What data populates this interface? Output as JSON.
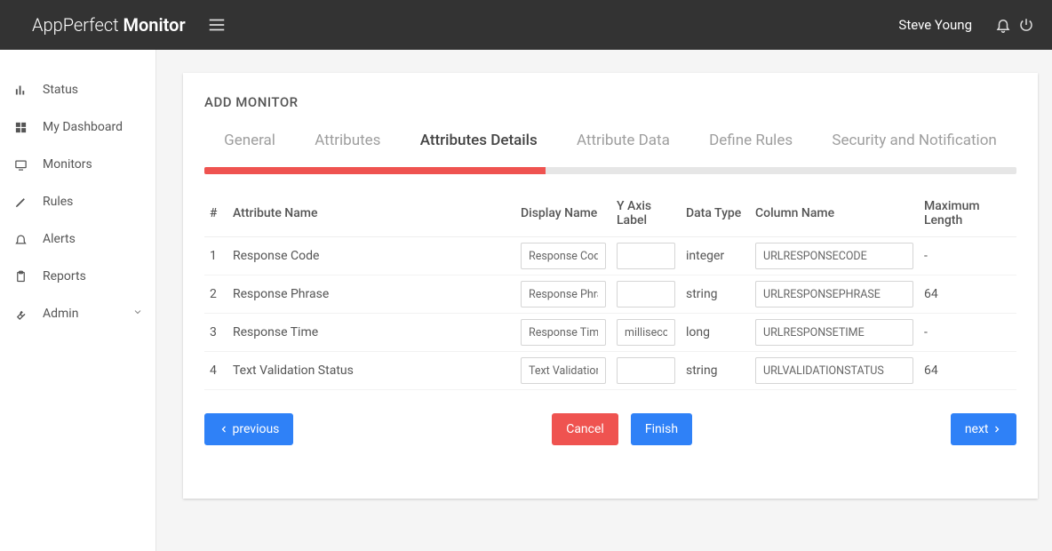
{
  "brand": {
    "name1": "AppPerfect",
    "name2": "Monitor"
  },
  "user": {
    "name": "Steve Young"
  },
  "sidebar": {
    "items": [
      {
        "label": "Status"
      },
      {
        "label": "My Dashboard"
      },
      {
        "label": "Monitors"
      },
      {
        "label": "Rules"
      },
      {
        "label": "Alerts"
      },
      {
        "label": "Reports"
      },
      {
        "label": "Admin"
      }
    ]
  },
  "card": {
    "title": "ADD MONITOR",
    "tabs": {
      "t0": "General",
      "t1": "Attributes",
      "t2": "Attributes Details",
      "t3": "Attribute Data",
      "t4": "Define Rules",
      "t5": "Security and Notification"
    },
    "progress_percent": 42
  },
  "columns": {
    "c0": "#",
    "c1": "Attribute Name",
    "c2": "Display Name",
    "c3": "Y Axis Label",
    "c4": "Data Type",
    "c5": "Column Name",
    "c6": "Maximum Length"
  },
  "rows": [
    {
      "n": "1",
      "attr": "Response Code",
      "disp": "Response Code",
      "y": "",
      "dtype": "integer",
      "col": "URLRESPONSECODE",
      "max": "-"
    },
    {
      "n": "2",
      "attr": "Response Phrase",
      "disp": "Response Phrase",
      "y": "",
      "dtype": "string",
      "col": "URLRESPONSEPHRASE",
      "max": "64"
    },
    {
      "n": "3",
      "attr": "Response Time",
      "disp": "Response Time",
      "y": "milliseconds",
      "dtype": "long",
      "col": "URLRESPONSETIME",
      "max": "-"
    },
    {
      "n": "4",
      "attr": "Text Validation Status",
      "disp": "Text Validation Status",
      "y": "",
      "dtype": "string",
      "col": "URLVALIDATIONSTATUS",
      "max": "64"
    }
  ],
  "buttons": {
    "previous": "previous",
    "cancel": "Cancel",
    "finish": "Finish",
    "next": "next"
  }
}
